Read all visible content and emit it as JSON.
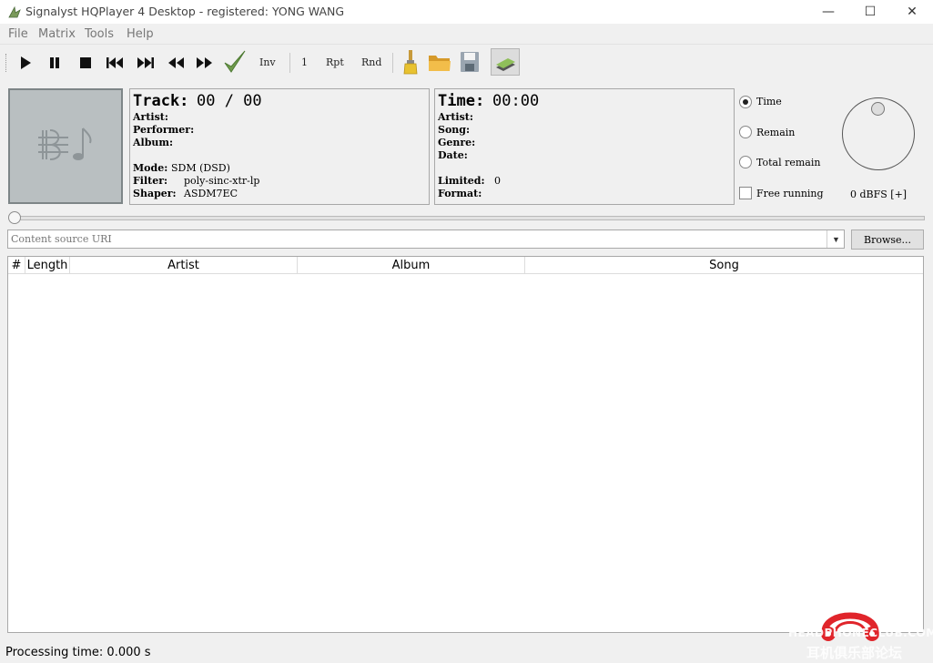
{
  "window": {
    "title": "Signalyst HQPlayer 4 Desktop - registered: YONG WANG",
    "minimize": "—",
    "maximize": "☐",
    "close": "✕"
  },
  "menu": [
    "File",
    "Matrix",
    "Tools",
    "Help"
  ],
  "toolbar": {
    "inv_label": "Inv",
    "one_label": "1",
    "rpt_label": "Rpt",
    "rnd_label": "Rnd"
  },
  "track_panel": {
    "track_label": "Track:",
    "track_value": "00 / 00",
    "artist_label": "Artist:",
    "performer_label": "Performer:",
    "album_label": "Album:",
    "mode_label": "Mode:",
    "mode_value": "SDM (DSD)",
    "filter_label": "Filter:",
    "filter_value": "poly-sinc-xtr-lp",
    "shaper_label": "Shaper:",
    "shaper_value": "ASDM7EC"
  },
  "time_panel": {
    "time_label": "Time:",
    "time_value": "00:00",
    "artist_label": "Artist:",
    "song_label": "Song:",
    "genre_label": "Genre:",
    "date_label": "Date:",
    "limited_label": "Limited:",
    "limited_value": "0",
    "format_label": "Format:"
  },
  "display_options": {
    "time": "Time",
    "remain": "Remain",
    "total_remain": "Total remain",
    "free_running": "Free running",
    "selected": "Time"
  },
  "volume": {
    "readout": "0 dBFS [+]"
  },
  "source": {
    "placeholder": "Content source URI",
    "browse_label": "Browse..."
  },
  "playlist": {
    "columns": [
      "#",
      "Length",
      "Artist",
      "Album",
      "Song"
    ],
    "rows": []
  },
  "status": {
    "text": "Processing time: 0.000 s"
  },
  "watermark": {
    "line1": "HEADPHONECLUB.COM",
    "line2": "耳机俱乐部论坛",
    "color": "#e0252b"
  }
}
